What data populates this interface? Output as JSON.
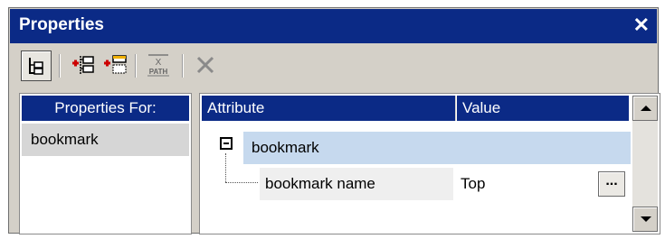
{
  "window": {
    "title": "Properties",
    "close_glyph": "✕"
  },
  "toolbar": {
    "buttons": [
      {
        "icon": "tree-view-icon",
        "selected": true
      },
      {
        "icon": "insert-attribute-icon"
      },
      {
        "icon": "append-attribute-icon"
      },
      {
        "icon": "xpath-icon",
        "label_top": "X",
        "label_bottom": "PATH"
      },
      {
        "icon": "delete-icon"
      }
    ]
  },
  "left_panel": {
    "header": "Properties For:",
    "items": [
      "bookmark"
    ]
  },
  "right_panel": {
    "columns": [
      "Attribute",
      "Value"
    ],
    "tree": [
      {
        "label": "bookmark",
        "expanded": true
      },
      {
        "attribute": "bookmark name",
        "value": "Top"
      }
    ],
    "edit_button": "..."
  },
  "colors": {
    "title_bar": "#0b2a86",
    "selected_row": "#c6d9ee",
    "panel_bg": "#d4d0c8"
  }
}
